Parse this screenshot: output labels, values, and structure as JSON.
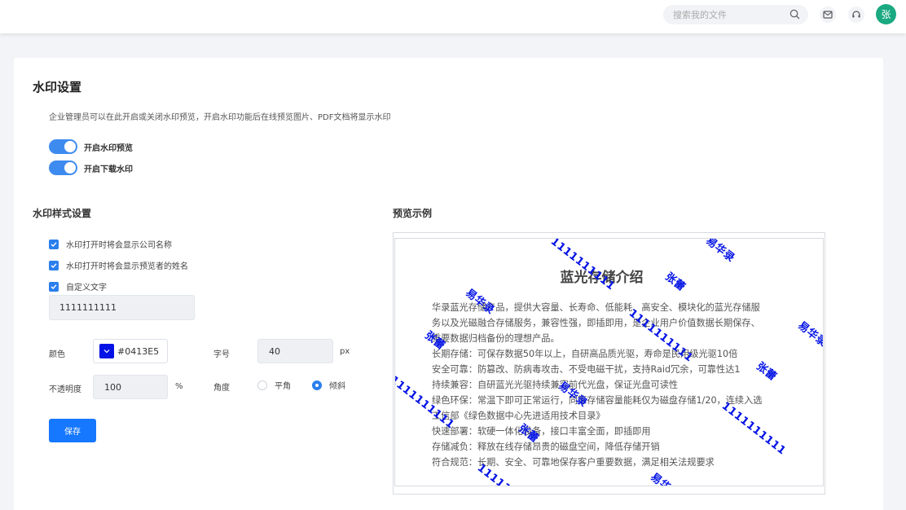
{
  "header": {
    "search_placeholder": "搜索我的文件",
    "avatar_text": "张",
    "icons": [
      "search-icon",
      "mail-icon",
      "headset-icon"
    ]
  },
  "page": {
    "title": "水印设置",
    "description": "企业管理员可以在此开启或关闭水印预览，开启水印功能后在线预览图片、PDF文档将显示水印"
  },
  "switches": [
    {
      "label": "开启水印预览",
      "on": true
    },
    {
      "label": "开启下载水印",
      "on": true
    }
  ],
  "style_section": {
    "title": "水印样式设置",
    "checkboxes": [
      {
        "label": "水印打开时将会显示公司名称",
        "checked": true
      },
      {
        "label": "水印打开时将会显示预览者的姓名",
        "checked": true
      },
      {
        "label": "自定义文字",
        "checked": true
      }
    ],
    "custom_text": "1111111111",
    "color_label": "颜色",
    "color_value": "#0413E5",
    "font_size_label": "字号",
    "font_size_value": "40",
    "font_size_unit": "px",
    "opacity_label": "不透明度",
    "opacity_value": "100",
    "opacity_unit": "%",
    "angle_label": "角度",
    "angle_options": [
      {
        "label": "平角",
        "checked": false
      },
      {
        "label": "倾斜",
        "checked": true
      }
    ],
    "save_label": "保存"
  },
  "preview": {
    "title": "预览示例",
    "doc_title": "蓝光存储介绍",
    "doc_lines": [
      "华录蓝光存储产品，提供大容量、长寿命、低能耗、高安全、模块化的蓝光存储服",
      "务以及光磁融合存储服务，兼容性强，即插即用，是企业用户价值数据长期保存、",
      "重要数据归档备份的理想产品。",
      "长期存储：可保存数据50年以上，自研高品质光驱，寿命是民用级光驱10倍",
      "安全可靠：防篡改、防病毒攻击、不受电磁干扰，支持Raid冗余，可靠性达1",
      "持续兼容：自研蓝光光驱持续兼容前代光盘，保证光盘可读性",
      "绿色环保：常温下即可正常运行，同等存储容量能耗仅为磁盘存储1/20，连续入选",
      "工信部《绿色数据中心先进适用技术目录》",
      "快速部署：软硬一体化设备，接口丰富全面，即插即用",
      "存储减负：释放在线存储昂贵的磁盘空间，降低存储开销",
      "符合规范：长期、安全、可靠地保存客户重要数据，满足相关法规要求"
    ],
    "watermarks": {
      "company": "易华录",
      "user": "张蕾",
      "custom": "1111111111"
    }
  },
  "colors": {
    "accent": "#1677ff",
    "toggle": "#3e8bf0",
    "watermark": "#0413E5",
    "avatar": "#1aa981"
  }
}
